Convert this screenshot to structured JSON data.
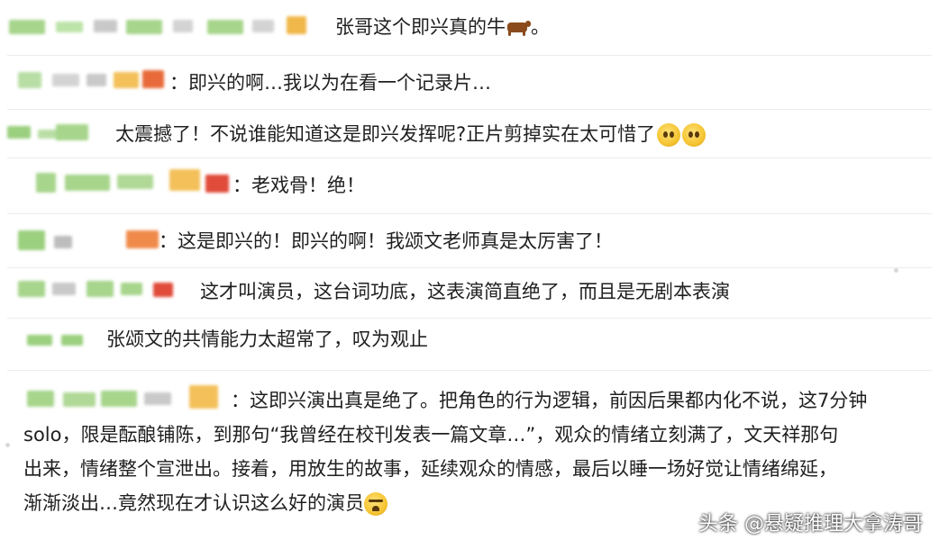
{
  "comments": [
    {
      "text": "张哥这个即兴真的牛"
    },
    {
      "prefix": "：",
      "text": "即兴的啊…我以为在看一个记录片…"
    },
    {
      "text": "太震撼了！不说谁能知道这是即兴发挥呢?正片剪掉实在太可惜了"
    },
    {
      "prefix": "：",
      "text": "老戏骨！绝！"
    },
    {
      "prefix": "：",
      "text": "这是即兴的！即兴的啊！我颂文老师真是太厉害了！"
    },
    {
      "text": "这才叫演员，这台词功底，这表演简直绝了，而且是无剧本表演"
    },
    {
      "text": "张颂文的共情能力太超常了，叹为观止"
    },
    {
      "lines": [
        "：这即兴演出真是绝了。把角色的行为逻辑，前因后果都内化不说，这7分钟",
        "solo，限是酝酿铺陈，到那句“我曾经在校刊发表一篇文章…”，观众的情绪立刻满了，文天祥那句",
        "出来，情绪整个宣泄出。接着，用放生的故事，延续观众的情感，最后以睡一场好觉让情绪绵延，",
        "渐渐淡出…竟然现在才认识这么好的演员"
      ]
    }
  ],
  "watermark": "头条 @悬疑推理大拿涛哥",
  "colors": {
    "blur_green": "#9bd07f",
    "blur_yellow": "#f3c05a",
    "blur_red": "#e04b3a",
    "blur_gray": "#bdbdbd"
  }
}
